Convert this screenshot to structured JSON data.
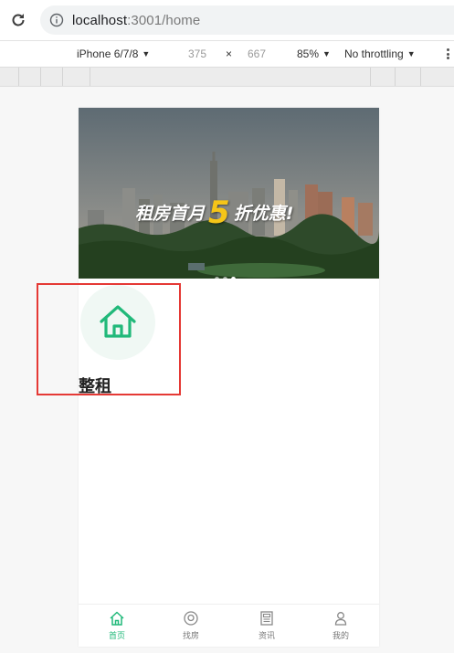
{
  "browser": {
    "url_host": "localhost",
    "url_rest": ":3001/home"
  },
  "device_toolbar": {
    "device": "iPhone 6/7/8",
    "width": "375",
    "times": "×",
    "height": "667",
    "zoom": "85%",
    "throttling": "No throttling"
  },
  "banner": {
    "text_before": "租房首月",
    "text_number": "5",
    "text_after": "折优惠!",
    "slide_count": 3,
    "active_slide": 2
  },
  "nav": {
    "items": [
      {
        "label": "整租",
        "icon": "house-icon"
      }
    ]
  },
  "tabbar": {
    "tabs": [
      {
        "label": "首页",
        "icon": "home-icon",
        "active": true
      },
      {
        "label": "找房",
        "icon": "search-icon",
        "active": false
      },
      {
        "label": "资讯",
        "icon": "news-icon",
        "active": false
      },
      {
        "label": "我的",
        "icon": "user-icon",
        "active": false
      }
    ]
  },
  "colors": {
    "accent": "#21b97a",
    "highlight": "#e53935"
  }
}
